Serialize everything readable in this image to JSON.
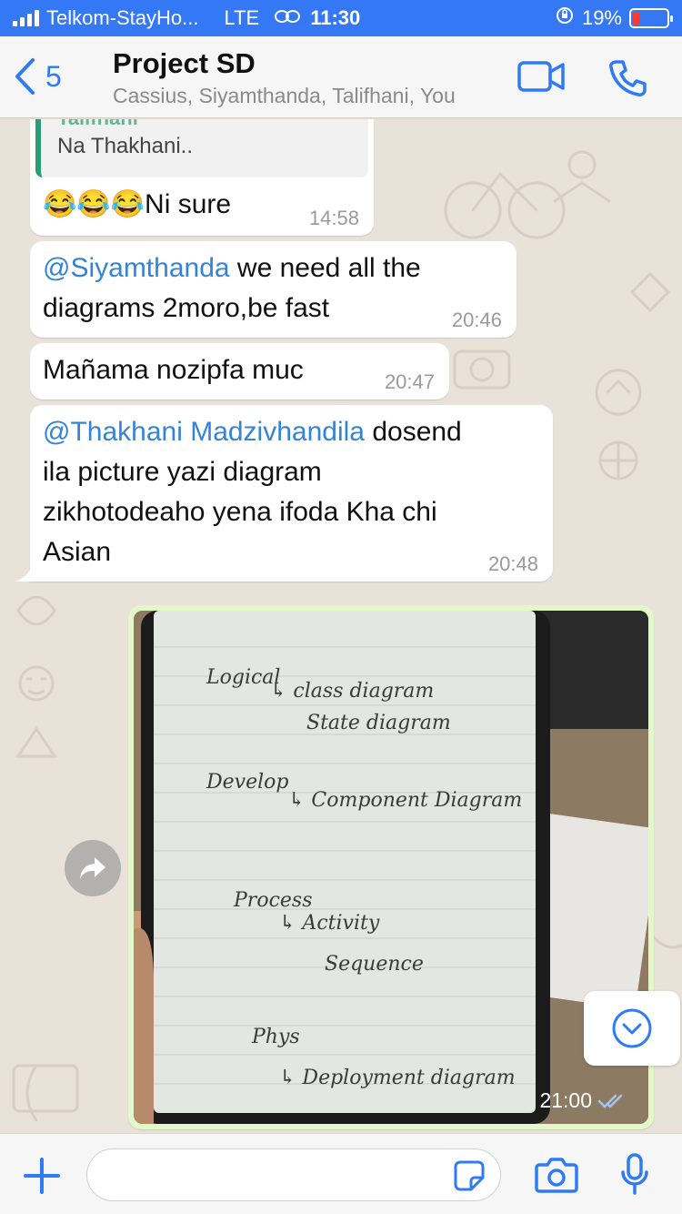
{
  "status_bar": {
    "carrier": "Telkom-StayHo...",
    "network": "LTE",
    "time": "11:30",
    "battery": "19%",
    "battery_level": 0.19
  },
  "header": {
    "back_count": "5",
    "title": "Project SD",
    "participants": "Cassius, Siyamthanda, Talifhani, You"
  },
  "messages": [
    {
      "quote_name": "Talifhani",
      "quote_text": "Na Thakhani..",
      "text": "😂😂😂Ni sure",
      "time": "14:58"
    },
    {
      "mention": "@Siyamthanda",
      "text_line1": " we need all the",
      "text_line2": "diagrams 2moro,be fast",
      "time": "20:46"
    },
    {
      "text": "Mañama nozipfa muc",
      "time": "20:47"
    },
    {
      "mention": "@Thakhani Madzivhandila",
      "text_line1": " dosend",
      "text_line2": "ila picture yazi diagram",
      "text_line3": "zikhotodeaho yena ifoda Kha chi",
      "text_line4": "Asian",
      "time": "20:48"
    }
  ],
  "image_message": {
    "time": "21:00",
    "handwriting": [
      "Logical",
      "↳ class diagram",
      "State diagram",
      "Develop",
      "↳ Component Diagram",
      "Process",
      "↳ Activity",
      "Sequence",
      "Phys",
      "↳ Deployment diagram"
    ]
  },
  "input": {
    "placeholder": ""
  },
  "colors": {
    "accent": "#2f7af5",
    "status_bar": "#3478f6",
    "mention": "#3383d9",
    "outgoing_bubble": "#e3f8c8",
    "quote_bar": "#2a9d74"
  }
}
